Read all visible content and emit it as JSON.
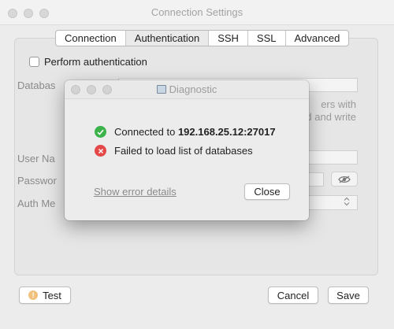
{
  "window": {
    "title": "Connection Settings"
  },
  "tabs": [
    "Connection",
    "Authentication",
    "SSH",
    "SSL",
    "Advanced"
  ],
  "auth": {
    "perform_label": "Perform authentication",
    "database_label": "Databas",
    "helper_line1": "ers with",
    "helper_line2": "d and write",
    "username_label": "User Na",
    "password_label": "Passwor",
    "mechanism_label": "Auth Me"
  },
  "footer": {
    "test_label": "Test",
    "cancel_label": "Cancel",
    "save_label": "Save"
  },
  "dialog": {
    "title": "Diagnostic",
    "status": [
      {
        "type": "success",
        "prefix": "Connected to ",
        "host": "192.168.25.12:27017",
        "color": "#3cb34a"
      },
      {
        "type": "error",
        "text": "Failed to load list of databases",
        "color": "#e44848"
      }
    ],
    "link_label": "Show error details",
    "close_label": "Close"
  }
}
